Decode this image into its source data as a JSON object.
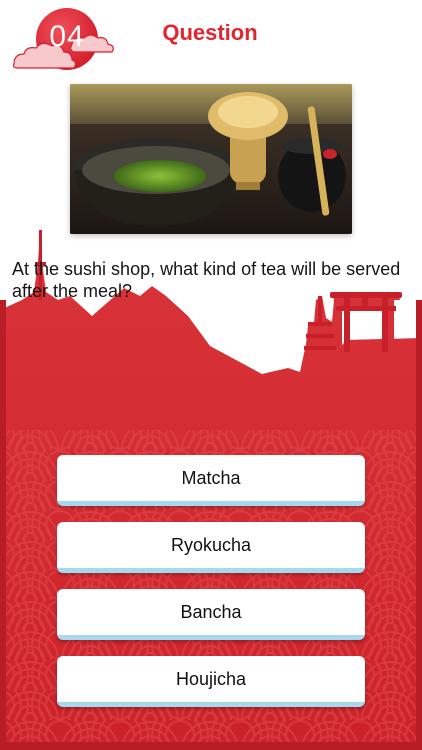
{
  "header": {
    "question_number": "04",
    "title": "Question"
  },
  "question": {
    "text": "At the sushi shop, what kind of tea will be served after the meal?",
    "image_icon": "matcha-tea-photo"
  },
  "answers": [
    {
      "label": "Matcha"
    },
    {
      "label": "Ryokucha"
    },
    {
      "label": "Bancha"
    },
    {
      "label": "Houjicha"
    }
  ],
  "colors": {
    "accent_red": "#e2252f",
    "background_red": "#d42a30",
    "answer_border": "#a6d8ef"
  }
}
